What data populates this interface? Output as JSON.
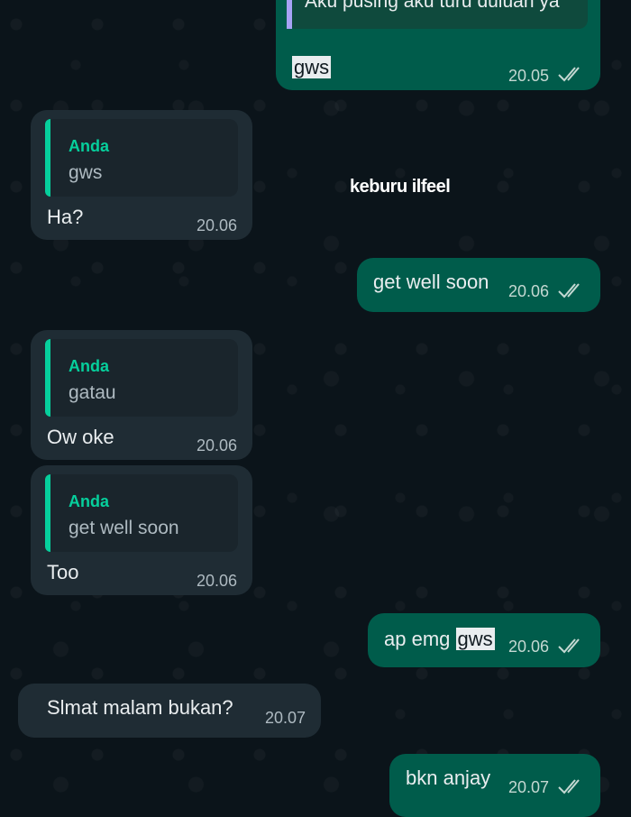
{
  "messages": [
    {
      "id": "m0",
      "dir": "out",
      "quote_text": "Aku pusing aku turu duluan ya",
      "text": "gws",
      "time": "20.05",
      "ticks": "double-check-icon"
    },
    {
      "id": "m1",
      "dir": "in",
      "quote_sender": "Anda",
      "quote_text": "gws",
      "text": "Ha?",
      "time": "20.06"
    },
    {
      "id": "m2",
      "dir": "out",
      "text": "get well soon",
      "time": "20.06",
      "ticks": "double-check-icon"
    },
    {
      "id": "m3",
      "dir": "in",
      "quote_sender": "Anda",
      "quote_text": "gatau",
      "text": "Ow oke",
      "time": "20.06"
    },
    {
      "id": "m4",
      "dir": "in",
      "quote_sender": "Anda",
      "quote_text": "get well soon",
      "text": "Too",
      "time": "20.06"
    },
    {
      "id": "m5",
      "dir": "out",
      "text_prefix": "ap emg ",
      "text_highlight": "gws",
      "time": "20.06",
      "ticks": "double-check-icon"
    },
    {
      "id": "m6",
      "dir": "in",
      "text": "Slmat malam bukan?",
      "time": "20.07"
    },
    {
      "id": "m7",
      "dir": "out",
      "text": "bkn anjay",
      "time": "20.07",
      "ticks": "double-check-icon"
    }
  ],
  "overlay_caption": "keburu ilfeel",
  "colors": {
    "incoming": "#1f2c34",
    "outgoing": "#005c4b",
    "accent": "#06cf9c",
    "background": "#0b141a"
  }
}
